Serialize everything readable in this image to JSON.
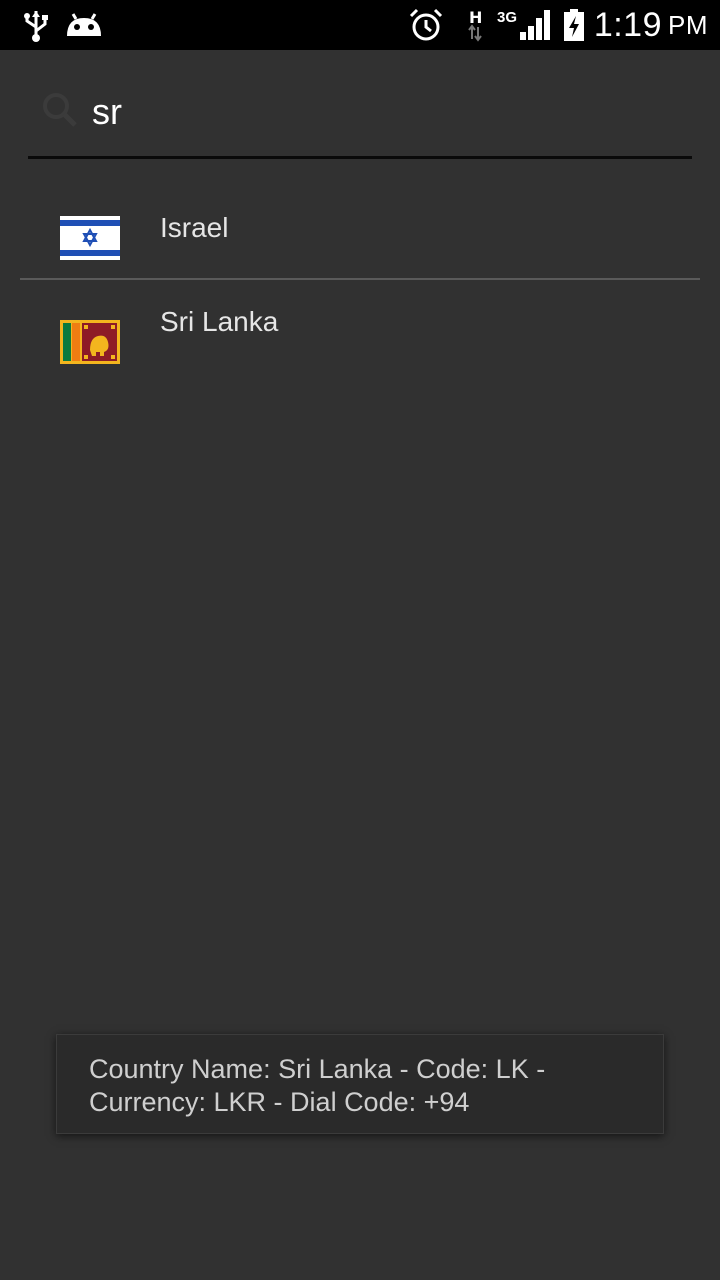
{
  "status_bar": {
    "time": "1:19",
    "ampm": "PM",
    "network_type": "3G",
    "data_indicator": "H",
    "icons": [
      "usb-icon",
      "android-debug-icon",
      "alarm-icon",
      "data-activity-icon",
      "signal-icon",
      "battery-charging-icon"
    ]
  },
  "search": {
    "value": "sr",
    "icon": "search-icon"
  },
  "countries": [
    {
      "name": "Israel",
      "flag": "israel-flag-icon"
    },
    {
      "name": "Sri Lanka",
      "flag": "sri-lanka-flag-icon"
    }
  ],
  "toast": {
    "line1": "Country Name: Sri Lanka - Code: LK -",
    "line2": "Currency: LKR - Dial Code: +94"
  },
  "colors": {
    "background": "#313131",
    "status_bar": "#000000",
    "text": "#e6e6e6"
  }
}
